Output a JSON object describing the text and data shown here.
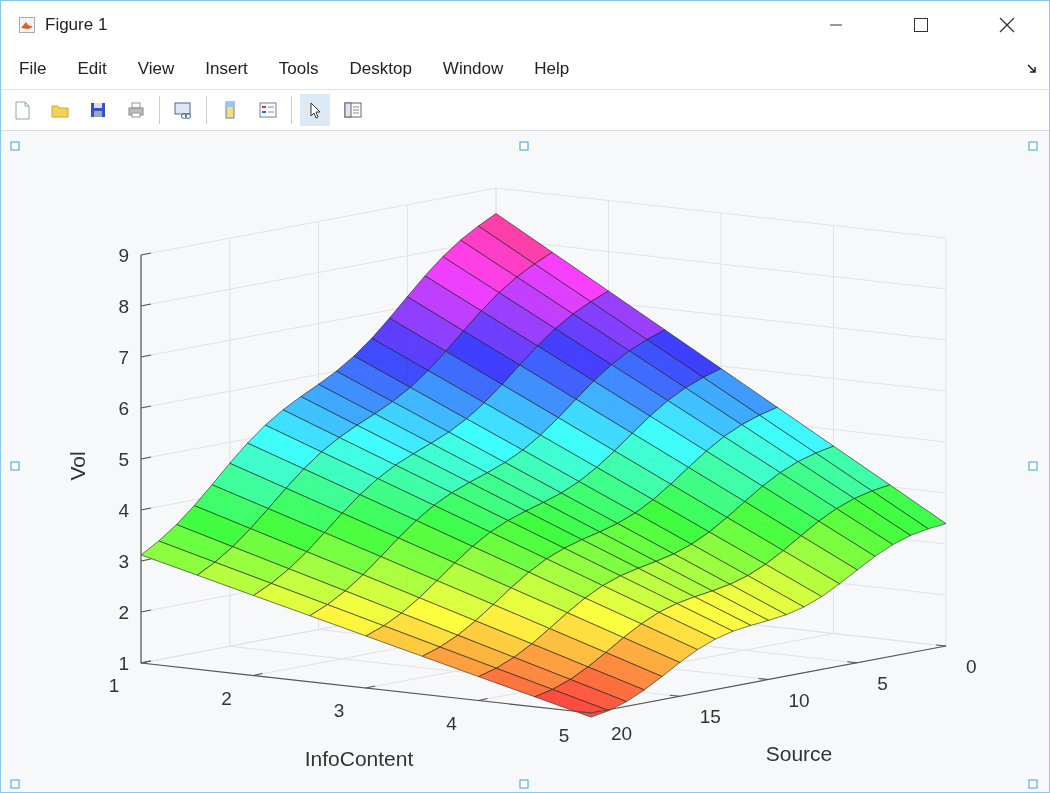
{
  "window": {
    "title": "Figure 1"
  },
  "menu": [
    "File",
    "Edit",
    "View",
    "Insert",
    "Tools",
    "Desktop",
    "Window",
    "Help"
  ],
  "toolbar": [
    {
      "kind": "new",
      "selected": false
    },
    {
      "kind": "open",
      "selected": false
    },
    {
      "kind": "save",
      "selected": false
    },
    {
      "kind": "print",
      "selected": false
    },
    {
      "kind": "sep"
    },
    {
      "kind": "link",
      "selected": false
    },
    {
      "kind": "sep"
    },
    {
      "kind": "colorbar",
      "selected": false
    },
    {
      "kind": "legend",
      "selected": false
    },
    {
      "kind": "sep"
    },
    {
      "kind": "pointer",
      "selected": true
    },
    {
      "kind": "property",
      "selected": false
    }
  ],
  "plot": {
    "zlabel": "Vol",
    "xlabel": "InfoContent",
    "ylabel": "Source",
    "zticks": [
      "9",
      "8",
      "7",
      "6",
      "5",
      "4",
      "3",
      "2",
      "1"
    ],
    "xticks": [
      "1",
      "2",
      "3",
      "4",
      "5"
    ],
    "yticks": [
      "0",
      "5",
      "10",
      "15",
      "20"
    ]
  }
}
